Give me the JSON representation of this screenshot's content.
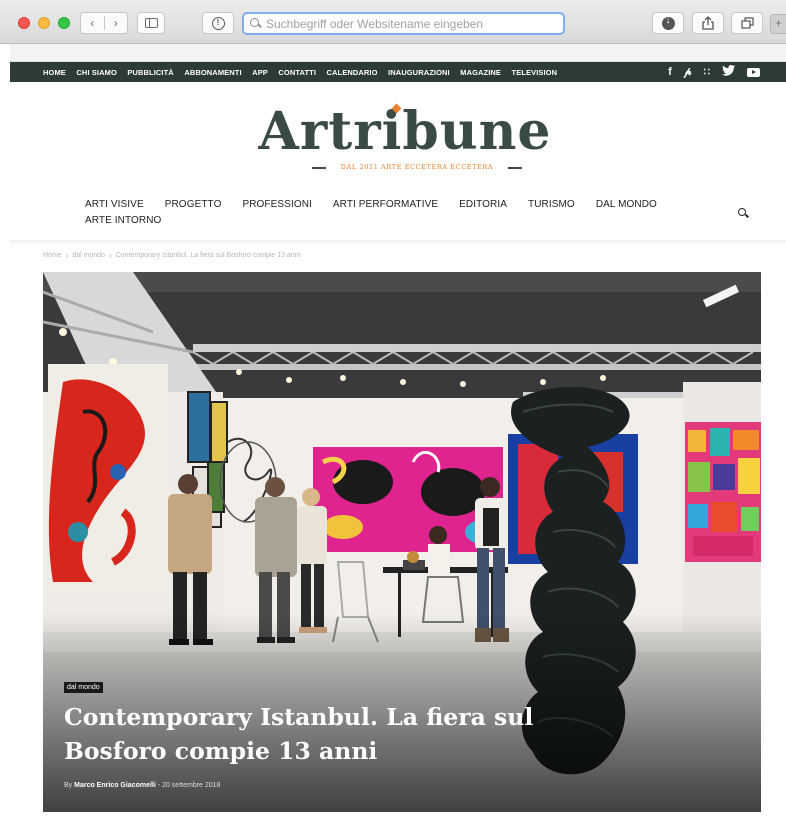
{
  "browser": {
    "address_placeholder": "Suchbegriff oder Websitename eingeben",
    "address_value": "",
    "back_icon": "chevron-left-icon",
    "forward_icon": "chevron-right-icon"
  },
  "site": {
    "top_nav": [
      "HOME",
      "CHI SIAMO",
      "PUBBLICITÀ",
      "ABBONAMENTI",
      "APP",
      "CONTATTI",
      "CALENDARIO",
      "INAUGURAZIONI",
      "MAGAZINE",
      "TELEVISION"
    ],
    "social": [
      "facebook-icon",
      "pinterest-icon",
      "rss-icon",
      "twitter-icon",
      "youtube-icon"
    ],
    "logo_text": "Artribune",
    "logo_tagline": "DAL 2011 ARTE ECCETERA ECCETERA",
    "main_nav": [
      "ARTI VISIVE",
      "PROGETTO",
      "PROFESSIONI",
      "ARTI PERFORMATIVE",
      "EDITORIA",
      "TURISMO",
      "DAL MONDO",
      "ARTE INTORNO"
    ],
    "accent": "#e8812a",
    "topbar_color": "#2d3b37"
  },
  "breadcrumb": [
    "Home",
    "dal mondo",
    "Contemporary Istanbul. La fiera sul Bosforo compie 13 anni"
  ],
  "article": {
    "category": "dal mondo",
    "title": "Contemporary Istanbul. La fiera sul Bosforo compie 13 anni",
    "by": "By",
    "author": "Marco Enrico Giacomelli",
    "date_sep": "-",
    "date": "20 settembre 2018"
  }
}
